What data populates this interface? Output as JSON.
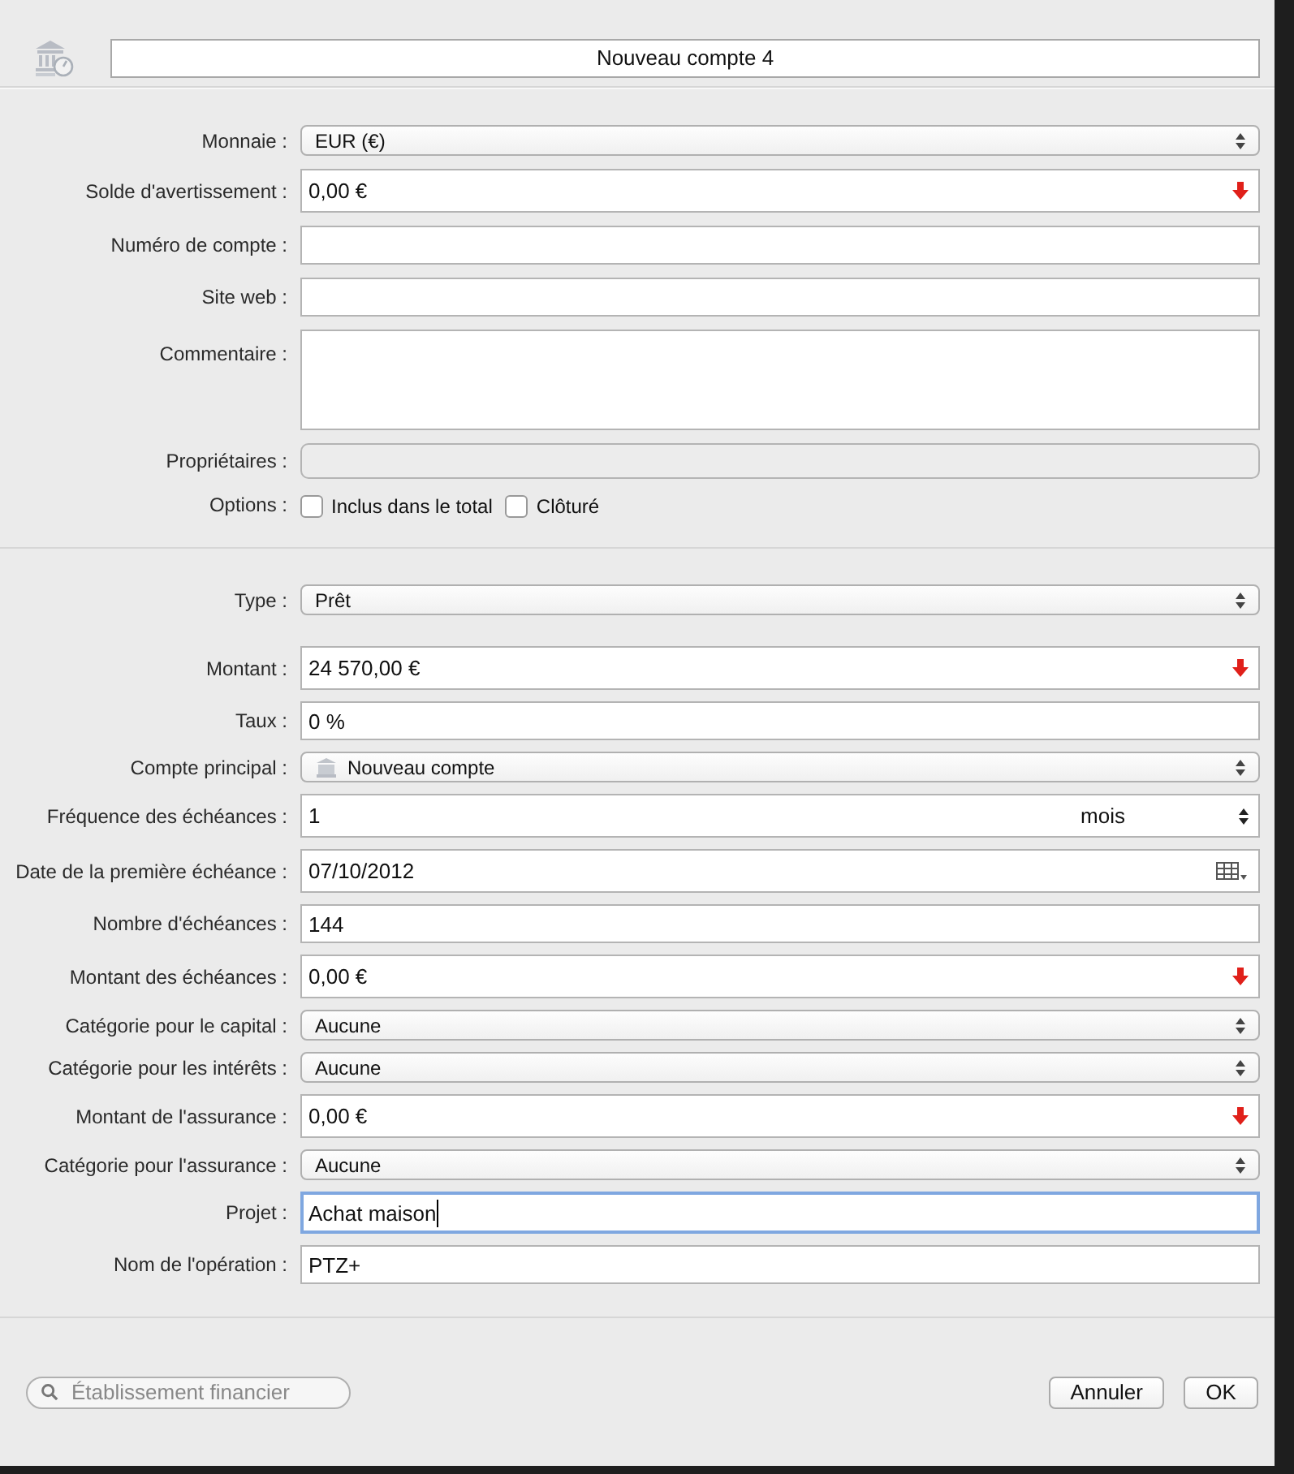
{
  "header": {
    "title": "Nouveau compte 4"
  },
  "sections": [
    {
      "rows": [
        {
          "kind": "select",
          "label": "Monnaie :",
          "value": "EUR (€)"
        },
        {
          "kind": "amount",
          "label": "Solde d'avertissement :",
          "value": "0,00 €"
        },
        {
          "kind": "text",
          "label": "Numéro de compte :"
        },
        {
          "kind": "text",
          "label": "Site web :"
        },
        {
          "kind": "textarea",
          "label": "Commentaire :"
        },
        {
          "kind": "tokens",
          "label": "Propriétaires :"
        },
        {
          "kind": "options",
          "label": "Options :",
          "options": [
            {
              "label": "Inclus dans le total",
              "checked": false
            },
            {
              "label": "Clôturé",
              "checked": false
            }
          ]
        }
      ]
    },
    {
      "rows": [
        {
          "kind": "select",
          "label": "Type :",
          "value": "Prêt"
        },
        {
          "kind": "amount",
          "label": "Montant :",
          "value": "24 570,00 €"
        },
        {
          "kind": "text",
          "label": "Taux :",
          "value": "0 %"
        },
        {
          "kind": "account",
          "label": "Compte principal :",
          "value": "Nouveau compte"
        },
        {
          "kind": "frequency",
          "label": "Fréquence des échéances :",
          "value": "1",
          "unit": "mois"
        },
        {
          "kind": "date",
          "label": "Date de la première échéance :",
          "value": "07/10/2012"
        },
        {
          "kind": "text",
          "label": "Nombre d'échéances :",
          "value": "144"
        },
        {
          "kind": "amount",
          "label": "Montant des échéances :",
          "value": "0,00 €"
        },
        {
          "kind": "select",
          "label": "Catégorie pour le capital :",
          "value": "Aucune"
        },
        {
          "kind": "select",
          "label": "Catégorie pour les intérêts :",
          "value": "Aucune"
        },
        {
          "kind": "amount",
          "label": "Montant de l'assurance :",
          "value": "0,00 €"
        },
        {
          "kind": "select",
          "label": "Catégorie pour l'assurance :",
          "value": "Aucune"
        },
        {
          "kind": "text",
          "label": "Projet :",
          "value": "Achat maison",
          "focused": true
        },
        {
          "kind": "text",
          "label": "Nom de l'opération :",
          "value": "PTZ+"
        }
      ]
    }
  ],
  "footer": {
    "search": {
      "placeholder": "Établissement financier"
    },
    "buttons": [
      "Annuler",
      "OK"
    ]
  }
}
